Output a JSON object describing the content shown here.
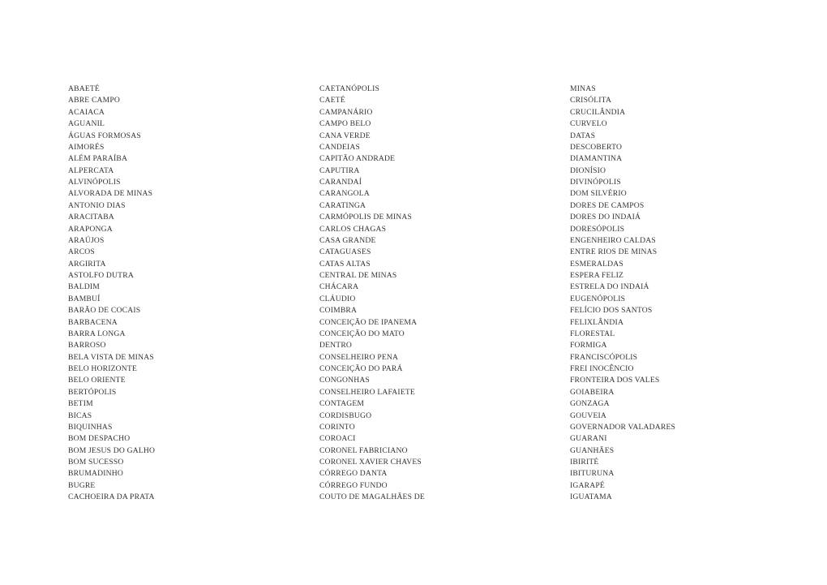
{
  "document": {
    "type": "text-listing",
    "description": "Three-column alphabetical listing of Minas Gerais municipality names in uppercase",
    "text_color": "#333333",
    "background_color": "#ffffff",
    "column_count": 3
  },
  "columns": [
    {
      "id": "column-1",
      "entries": [
        "ABAETÉ",
        "ABRE CAMPO",
        "ACAIACA",
        "AGUANIL",
        "ÁGUAS FORMOSAS",
        "AIMORÉS",
        "ALÉM PARAÍBA",
        "ALPERCATA",
        "ALVINÓPOLIS",
        "ALVORADA DE MINAS",
        "ANTONIO DIAS",
        "ARACITABA",
        "ARAPONGA",
        "ARAÚJOS",
        "ARCOS",
        "ARGIRITA",
        "ASTOLFO DUTRA",
        "BALDIM",
        "BAMBUÍ",
        "BARÃO DE COCAIS",
        "BARBACENA",
        "BARRA LONGA",
        "BARROSO",
        "BELA VISTA DE MINAS",
        "BELO HORIZONTE",
        "BELO ORIENTE",
        "BERTÓPOLIS",
        "BETIM",
        "BICAS",
        "BIQUINHAS",
        "BOM DESPACHO",
        "BOM JESUS DO GALHO",
        "BOM SUCESSO",
        "BRUMADINHO",
        "BUGRE",
        "CACHOEIRA DA PRATA"
      ]
    },
    {
      "id": "column-2",
      "entries": [
        "CAETANÓPOLIS",
        "CAETÉ",
        "CAMPANÁRIO",
        "CAMPO BELO",
        "CANA VERDE",
        "CANDEIAS",
        "CAPITÃO ANDRADE",
        "CAPUTIRA",
        "CARANDAÍ",
        "CARANGOLA",
        "CARATINGA",
        "CARMÓPOLIS DE MINAS",
        "CARLOS CHAGAS",
        "CASA GRANDE",
        "CATAGUASES",
        "CATAS ALTAS",
        "CENTRAL DE MINAS",
        "CHÁCARA",
        "CLÁUDIO",
        "COIMBRA",
        "CONCEIÇÃO DE IPANEMA",
        "CONCEIÇÃO DO MATO",
        "DENTRO",
        "CONSELHEIRO PENA",
        "CONCEIÇÃO DO PARÁ",
        "CONGONHAS",
        "CONSELHEIRO LAFAIETE",
        "CONTAGEM",
        "CORDISBUGO",
        "CORINTO",
        "COROACI",
        "CORONEL FABRICIANO",
        "CORONEL XAVIER CHAVES",
        "CÓRREGO DANTA",
        "CÓRREGO FUNDO",
        "COUTO DE MAGALHÃES DE"
      ]
    },
    {
      "id": "column-3",
      "entries": [
        "MINAS",
        "CRISÓLITA",
        "CRUCILÂNDIA",
        "CURVELO",
        "DATAS",
        "DESCOBERTO",
        "DIAMANTINA",
        "DIONÍSIO",
        "DIVINÓPOLIS",
        "DOM SILVÉRIO",
        "DORES DE CAMPOS",
        "DORES DO INDAIÁ",
        "DORESÓPOLIS",
        "ENGENHEIRO CALDAS",
        "ENTRE RIOS DE MINAS",
        "ESMERALDAS",
        "ESPERA FELIZ",
        "ESTRELA DO INDAIÁ",
        "EUGENÓPOLIS",
        "FELÍCIO DOS SANTOS",
        "FELIXLÂNDIA",
        "FLORESTAL",
        "FORMIGA",
        "FRANCISCÓPOLIS",
        "FREI INOCÊNCIO",
        "FRONTEIRA DOS VALES",
        "GOIABEIRA",
        "GONZAGA",
        "GOUVEIA",
        "GOVERNADOR VALADARES",
        "GUARANI",
        "GUANHÃES",
        "IBIRITÉ",
        "IBITURUNA",
        "IGARAPÉ",
        "IGUATAMA"
      ]
    }
  ]
}
